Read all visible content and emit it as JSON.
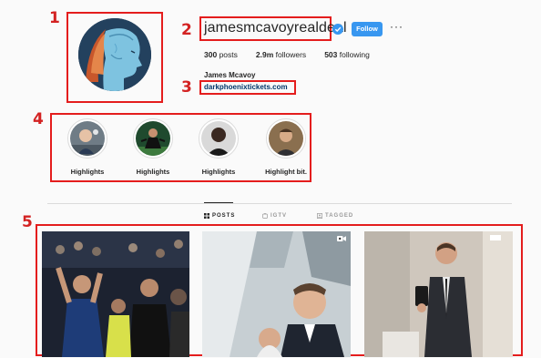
{
  "profile": {
    "username": "jamesmcavoyrealdeal",
    "follow_label": "Follow",
    "more_label": "···",
    "stats": {
      "posts_count": "300",
      "posts_label": "posts",
      "followers_count": "2.9m",
      "followers_label": "followers",
      "following_count": "503",
      "following_label": "following"
    },
    "full_name": "James Mcavoy",
    "website": "darkphoenixtickets.com"
  },
  "highlights": [
    {
      "label": "Highlights"
    },
    {
      "label": "Highlights"
    },
    {
      "label": "Highlights"
    },
    {
      "label": "Highlight bit."
    }
  ],
  "tabs": [
    {
      "label": "POSTS",
      "icon": "grid-icon",
      "active": true
    },
    {
      "label": "IGTV",
      "icon": "igtv-icon",
      "active": false
    },
    {
      "label": "TAGGED",
      "icon": "tagged-icon",
      "active": false
    }
  ],
  "annotations": [
    "1",
    "2",
    "3",
    "4",
    "5"
  ],
  "colors": {
    "annotation_red": "#e41d1d",
    "follow_blue": "#3897f0",
    "link_blue": "#00376b",
    "verified_blue": "#3897f0"
  }
}
